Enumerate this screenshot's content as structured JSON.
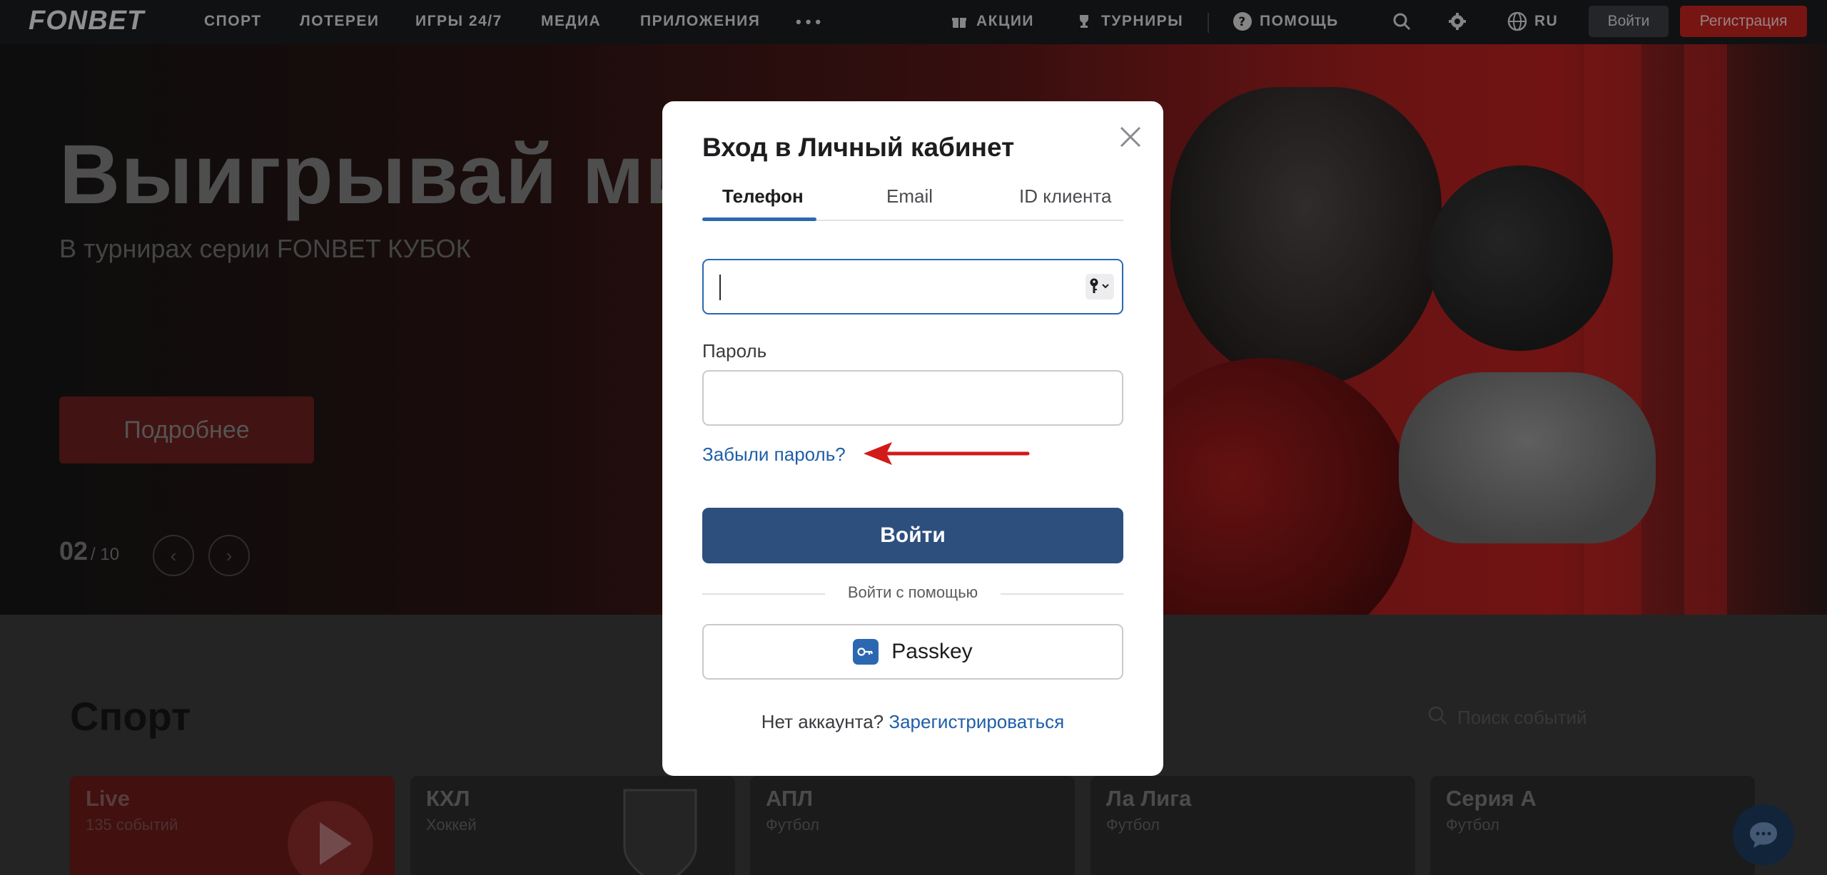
{
  "nav": {
    "logo": "FONBET",
    "items": [
      "СПОРТ",
      "ЛОТЕРЕИ",
      "ИГРЫ 24/7",
      "МЕДИА",
      "ПРИЛОЖЕНИЯ"
    ],
    "more": "•••",
    "promotions": "АКЦИИ",
    "tournaments": "ТУРНИРЫ",
    "help": "ПОМОЩЬ",
    "language": "RU",
    "login": "Войти",
    "register": "Регистрация"
  },
  "hero": {
    "title": "Выигрывай мил",
    "subtitle": "В турнирах серии FONBET КУБОК",
    "button": "Подробнее",
    "slide_current": "02",
    "slide_total": "/ 10"
  },
  "sport": {
    "title": "Спорт",
    "search_placeholder": "Поиск событий",
    "cards": [
      {
        "title": "Live",
        "subtitle": "135 событий"
      },
      {
        "title": "КХЛ",
        "subtitle": "Хоккей"
      },
      {
        "title": "АПЛ",
        "subtitle": "Футбол"
      },
      {
        "title": "Ла Лига",
        "subtitle": "Футбол"
      },
      {
        "title": "Серия А",
        "subtitle": "Футбол"
      }
    ]
  },
  "modal": {
    "title": "Вход в Личный кабинет",
    "tabs": [
      "Телефон",
      "Email",
      "ID клиента"
    ],
    "active_tab": "Телефон",
    "phone_value": "",
    "password_label": "Пароль",
    "password_value": "",
    "forgot": "Забыли пароль?",
    "submit": "Войти",
    "alt_login": "Войти с помощью",
    "passkey": "Passkey",
    "no_account": "Нет аккаунта?",
    "register": "Зарегистрироваться"
  },
  "colors": {
    "accent_blue": "#2b68b1",
    "submit_bg": "#2d4f7e",
    "brand_red": "#c1221f",
    "annotation_arrow": "#d11a1a"
  }
}
